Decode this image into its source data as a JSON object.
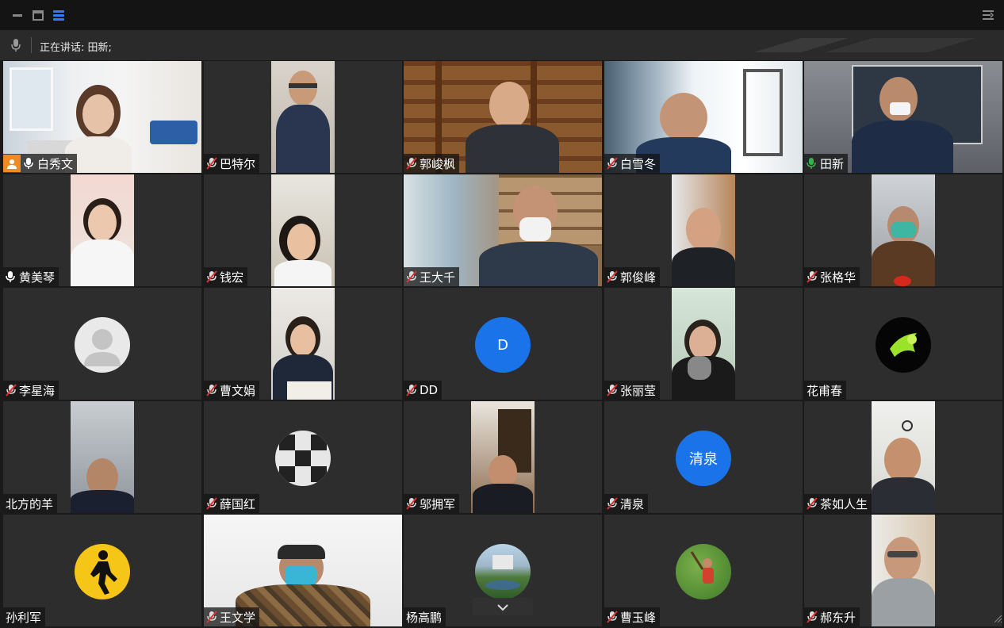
{
  "window": {
    "status_prefix": "正在讲话:",
    "current_speaker": "田新;"
  },
  "colors": {
    "active_border": "#37b24d",
    "host_badge": "#f08a24",
    "avatar_blue": "#1a73e8",
    "mic_muted": "#e03131"
  },
  "participants": [
    {
      "name": "白秀文",
      "mic": "on",
      "host": true,
      "view": "video"
    },
    {
      "name": "巴特尔",
      "mic": "muted",
      "view": "video"
    },
    {
      "name": "郭峻枫",
      "mic": "muted",
      "view": "video"
    },
    {
      "name": "白雪冬",
      "mic": "muted",
      "view": "video"
    },
    {
      "name": "田新",
      "mic": "speaking",
      "active": true,
      "view": "video"
    },
    {
      "name": "黄美琴",
      "mic": "on",
      "view": "video"
    },
    {
      "name": "钱宏",
      "mic": "muted",
      "view": "video"
    },
    {
      "name": "王大千",
      "mic": "muted",
      "view": "video"
    },
    {
      "name": "郭俊峰",
      "mic": "muted",
      "view": "video"
    },
    {
      "name": "张格华",
      "mic": "muted",
      "view": "video"
    },
    {
      "name": "李星海",
      "mic": "muted",
      "view": "avatar",
      "avatar_icon": "default-user-icon"
    },
    {
      "name": "曹文娟",
      "mic": "muted",
      "view": "video"
    },
    {
      "name": "DD",
      "mic": "muted",
      "view": "avatar",
      "avatar_text": "D"
    },
    {
      "name": "张丽莹",
      "mic": "muted",
      "view": "video"
    },
    {
      "name": "花甫春",
      "mic": "none",
      "view": "avatar",
      "avatar_icon": "green-splash-icon"
    },
    {
      "name": "北方的羊",
      "mic": "none",
      "view": "video"
    },
    {
      "name": "薛国红",
      "mic": "muted",
      "view": "avatar",
      "avatar_icon": "collage-icon"
    },
    {
      "name": "邬拥军",
      "mic": "muted",
      "view": "video"
    },
    {
      "name": "清泉",
      "mic": "muted",
      "view": "avatar",
      "avatar_text": "清泉"
    },
    {
      "name": "茶如人生",
      "mic": "muted",
      "view": "video"
    },
    {
      "name": "孙利军",
      "mic": "none",
      "view": "avatar",
      "avatar_icon": "runner-icon"
    },
    {
      "name": "王文学",
      "mic": "muted",
      "view": "video"
    },
    {
      "name": "杨高鹏",
      "mic": "none",
      "view": "avatar",
      "avatar_icon": "landscape-photo-icon"
    },
    {
      "name": "曹玉峰",
      "mic": "muted",
      "view": "avatar",
      "avatar_icon": "outdoor-photo-icon"
    },
    {
      "name": "郝东升",
      "mic": "muted",
      "view": "video"
    }
  ]
}
